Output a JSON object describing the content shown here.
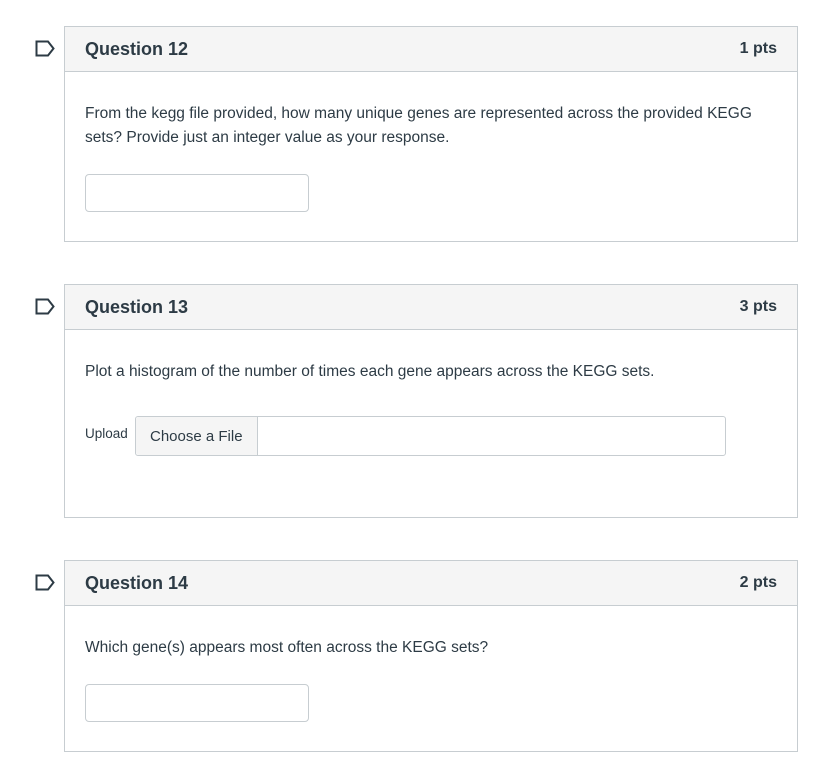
{
  "questions": [
    {
      "title": "Question 12",
      "points": "1 pts",
      "text": "From the kegg file provided, how many unique genes are represented across the provided KEGG sets? Provide just an integer value as your response.",
      "answer_value": ""
    },
    {
      "title": "Question 13",
      "points": "3 pts",
      "text": "Plot a histogram of the number of times each gene appears across the KEGG sets.",
      "upload_label": "Upload",
      "choose_file_label": "Choose a File"
    },
    {
      "title": "Question 14",
      "points": "2 pts",
      "text": "Which gene(s) appears most often across the KEGG sets?",
      "answer_value": ""
    }
  ],
  "icons": {
    "flag": "flag-outline-icon"
  },
  "colors": {
    "border": "#c7cdd1",
    "header_bg": "#f5f5f5",
    "text": "#2d3b45",
    "flag": "#2d3b45"
  }
}
